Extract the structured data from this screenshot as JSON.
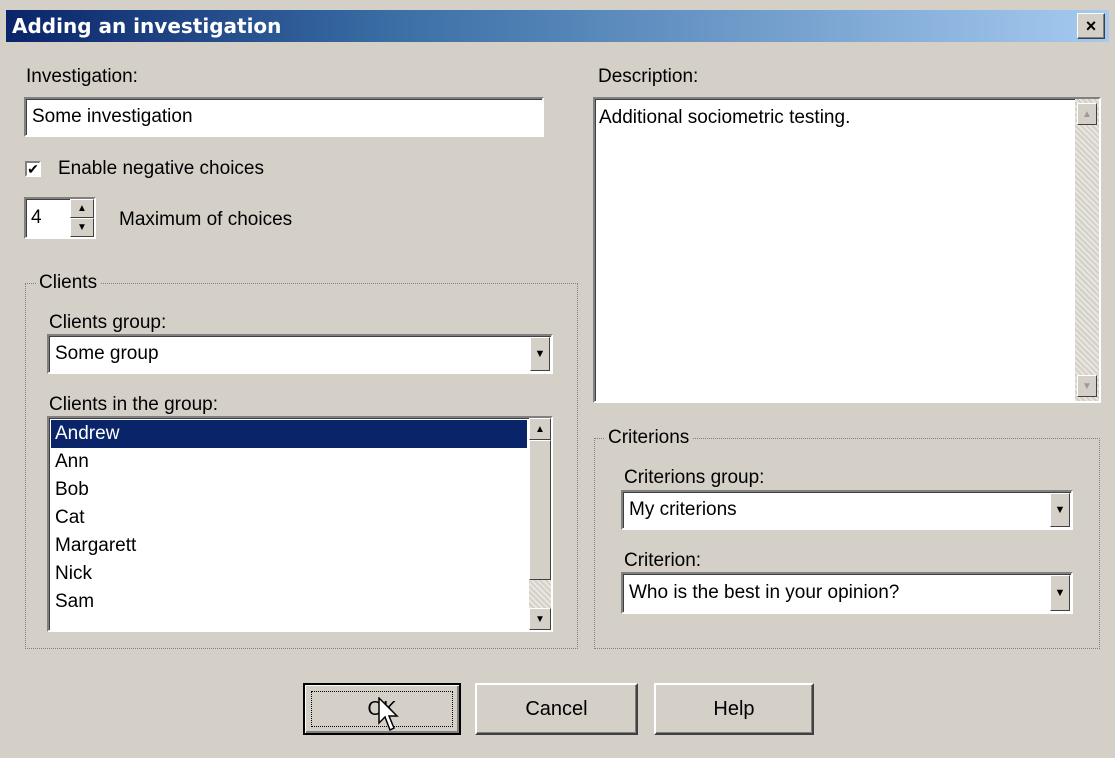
{
  "window": {
    "title": "Adding an investigation",
    "close_glyph": "×"
  },
  "investigation": {
    "label": "Investigation:",
    "value": "Some investigation"
  },
  "negative_choices": {
    "label": "Enable negative choices",
    "checked": true,
    "check_glyph": "✔"
  },
  "max_choices": {
    "value": "4",
    "label": "Maximum of choices"
  },
  "clients": {
    "group_title": "Clients",
    "group_label": "Clients group:",
    "group_value": "Some group",
    "list_label": "Clients in the group:",
    "items": [
      "Andrew",
      "Ann",
      "Bob",
      "Cat",
      "Margarett",
      "Nick",
      "Sam"
    ],
    "selected": "Andrew"
  },
  "description": {
    "label": "Description:",
    "value": "Additional sociometric testing."
  },
  "criterions": {
    "group_title": "Criterions",
    "group_label": "Criterions group:",
    "group_value": "My criterions",
    "criterion_label": "Criterion:",
    "criterion_value": "Who is the best in your opinion?"
  },
  "buttons": {
    "ok": "OK",
    "cancel": "Cancel",
    "help": "Help"
  },
  "colors": {
    "face": "#d4d0c8",
    "title_active": "#0a246a",
    "selection": "#0a246a"
  }
}
